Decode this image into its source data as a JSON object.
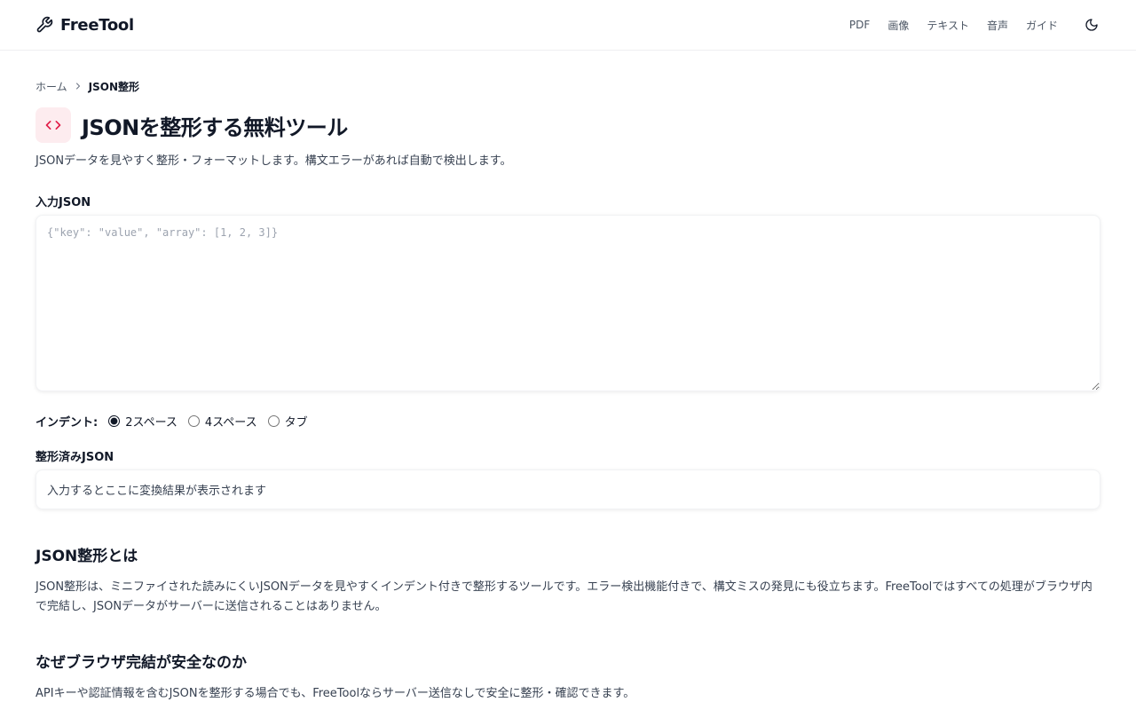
{
  "header": {
    "brand_name": "FreeTool",
    "nav": [
      "PDF",
      "画像",
      "テキスト",
      "音声",
      "ガイド"
    ]
  },
  "breadcrumb": {
    "home": "ホーム",
    "current": "JSON整形"
  },
  "page": {
    "title": "JSONを整形する無料ツール",
    "description": "JSONデータを見やすく整形・フォーマットします。構文エラーがあれば自動で検出します。"
  },
  "input": {
    "label": "入力JSON",
    "value": "",
    "placeholder": "{\"key\": \"value\", \"array\": [1, 2, 3]}"
  },
  "indent": {
    "label": "インデント:",
    "options": [
      "2スペース",
      "4スペース",
      "タブ"
    ],
    "selected": "2スペース"
  },
  "output": {
    "label": "整形済みJSON",
    "placeholder": "入力するとここに変換結果が表示されます"
  },
  "sections": [
    {
      "title": "JSON整形とは",
      "text": "JSON整形は、ミニファイされた読みにくいJSONデータを見やすくインデント付きで整形するツールです。エラー検出機能付きで、構文ミスの発見にも役立ちます。FreeToolではすべての処理がブラウザ内で完結し、JSONデータがサーバーに送信されることはありません。"
    },
    {
      "title": "なぜブラウザ完結が安全なのか",
      "text": "APIキーや認証情報を含むJSONを整形する場合でも、FreeToolならサーバー送信なしで安全に整形・確認できます。"
    }
  ],
  "icons": {
    "brand": "wrench-icon",
    "theme": "moon-icon",
    "title": "code-icon",
    "breadcrumb_separator": "chevron-right-icon"
  },
  "colors": {
    "accent": "#e11d48",
    "title_icon_bg": "#fdecef"
  }
}
